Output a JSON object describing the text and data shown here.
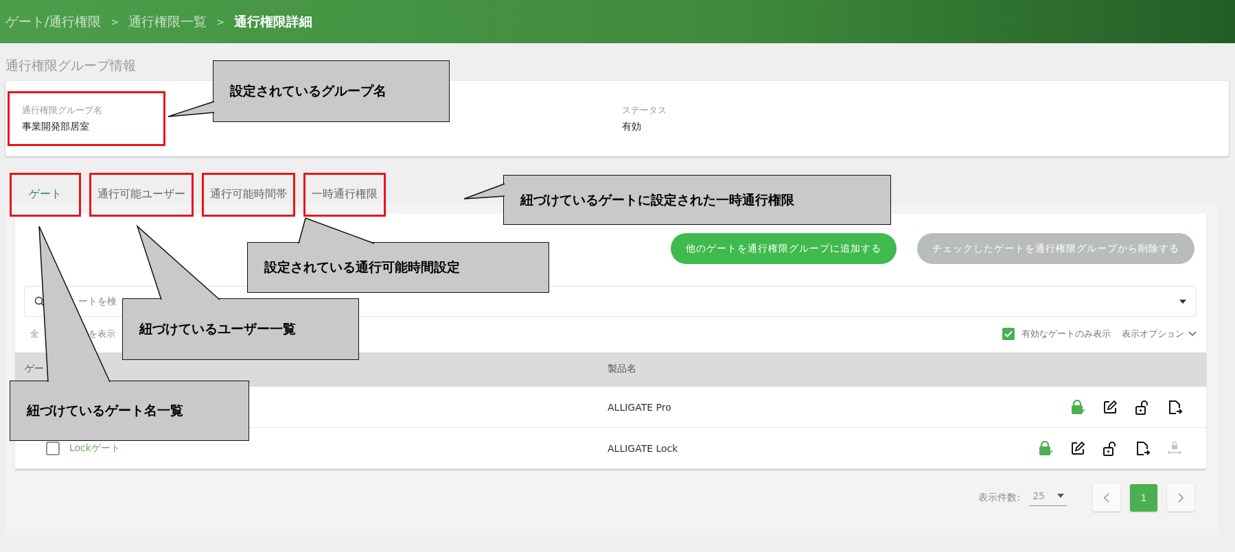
{
  "breadcrumb": [
    {
      "label": "ゲート/通行権限",
      "current": false
    },
    {
      "separator": ">",
      "label": "通行権限一覧",
      "current": false
    },
    {
      "separator": ">",
      "label": "通行権限詳細",
      "current": true
    }
  ],
  "section_title": "通行権限グループ情報",
  "info_fields": [
    {
      "label": "通行権限グループ名",
      "value": "事業開発部居室",
      "highlighted": true
    },
    {
      "label": "ステータス",
      "value": "有効",
      "highlighted": false
    }
  ],
  "tabs": [
    {
      "label": "ゲート",
      "selected": true,
      "highlighted": true
    },
    {
      "label": "通行可能ユーザー",
      "selected": false,
      "highlighted": true
    },
    {
      "label": "通行可能時間帯",
      "selected": false,
      "highlighted": true
    },
    {
      "label": "一時通行権限",
      "selected": false,
      "highlighted": true
    }
  ],
  "actions": [
    {
      "label": "他のゲートを通行権限グループに追加する",
      "disabled": false
    },
    {
      "label": "チェックしたゲートを通行権限グループから削除する",
      "disabled": true
    }
  ],
  "search": {
    "placeholder": "ートを検"
  },
  "show_all_fragments": [
    "全",
    "を表示"
  ],
  "filter": {
    "label": "有効なゲートのみ表示",
    "checked": true
  },
  "display_options": {
    "label": "表示オプション"
  },
  "table": {
    "columns": [
      "ゲー",
      "製品名"
    ],
    "rows": [
      {
        "product": "ALLIGATE Pro",
        "actions": [
          {
            "kind": "lock-check",
            "disabled": false
          },
          {
            "kind": "edit",
            "disabled": false
          },
          {
            "kind": "unlock",
            "disabled": false
          },
          {
            "kind": "export",
            "disabled": false
          }
        ]
      },
      {
        "gate": "Lockゲート",
        "checked": false,
        "product": "ALLIGATE Lock",
        "actions": [
          {
            "kind": "lock-check",
            "disabled": false
          },
          {
            "kind": "edit",
            "disabled": false
          },
          {
            "kind": "unlock",
            "disabled": false
          },
          {
            "kind": "export",
            "disabled": false
          },
          {
            "kind": "transfer",
            "disabled": true
          }
        ]
      }
    ]
  },
  "pagination": {
    "per_page_label": "表示件数:",
    "per_page": "25",
    "pages": [
      {
        "label": "1",
        "selected": true
      }
    ]
  },
  "callouts": [
    {
      "text": "設定されているグループ名"
    },
    {
      "text": "紐づけているゲートに設定された一時通行権限"
    },
    {
      "text": "設定されている通行可能時間設定"
    },
    {
      "text": "紐づけているユーザー一覧"
    },
    {
      "text": "紐づけているゲート名一覧"
    }
  ]
}
